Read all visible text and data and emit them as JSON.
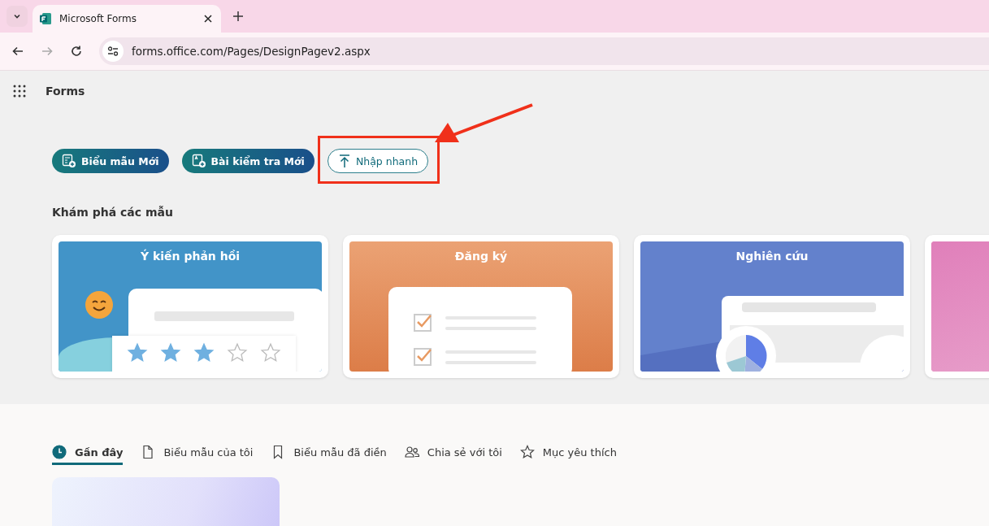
{
  "browser": {
    "tab_title": "Microsoft Forms",
    "url": "forms.office.com/Pages/DesignPagev2.aspx"
  },
  "app": {
    "title": "Forms"
  },
  "actions": [
    {
      "label": "Biểu mẫu Mới",
      "kind": "form"
    },
    {
      "label": "Bài kiểm tra Mới",
      "kind": "quiz"
    },
    {
      "label": "Nhập nhanh",
      "kind": "import"
    }
  ],
  "templates": {
    "heading": "Khám phá các mẫu",
    "cards": [
      {
        "title": "Ý kiến phản hồi",
        "kind": "feedback",
        "stars": 3
      },
      {
        "title": "Đăng ký",
        "kind": "registration"
      },
      {
        "title": "Nghiên cứu",
        "kind": "research"
      },
      {
        "kind": "partial"
      }
    ]
  },
  "tabs": [
    {
      "label": "Gần đây",
      "kind": "clock",
      "selected": true
    },
    {
      "label": "Biểu mẫu của tôi",
      "kind": "document",
      "selected": false
    },
    {
      "label": "Biểu mẫu đã điền",
      "kind": "bookmark",
      "selected": false
    },
    {
      "label": "Chia sẻ với tôi",
      "kind": "people",
      "selected": false
    },
    {
      "label": "Mục yêu thích",
      "kind": "star",
      "selected": false
    }
  ]
}
